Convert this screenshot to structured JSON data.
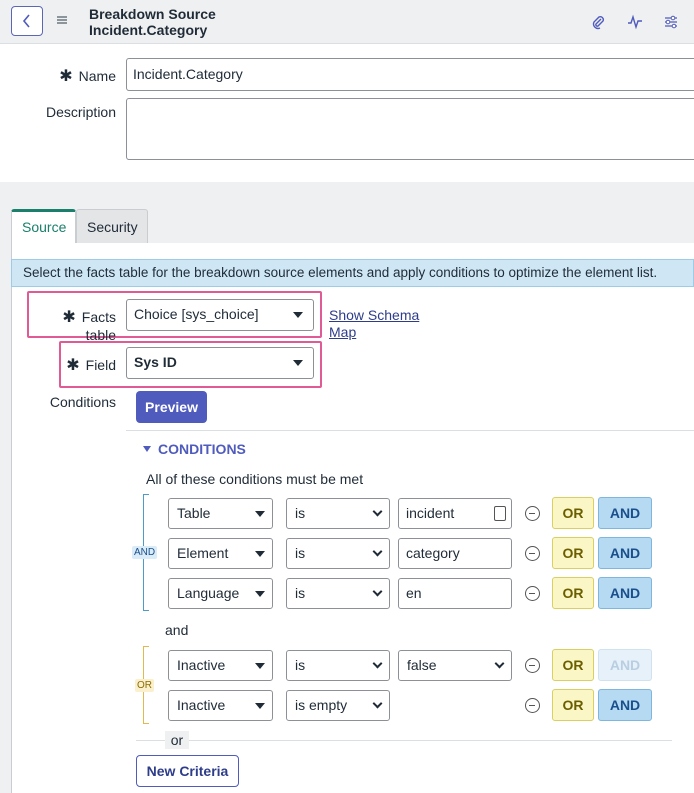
{
  "header": {
    "title_line1": "Breakdown Source",
    "title_line2": "Incident.Category",
    "icons": [
      "back-icon",
      "hamburger-icon",
      "paperclip-icon",
      "activity-icon",
      "settings-sliders-icon"
    ]
  },
  "form": {
    "name_label": "Name",
    "name_value": "Incident.Category",
    "description_label": "Description",
    "description_value": "",
    "required_mark": "✱"
  },
  "tabs": [
    {
      "label": "Source",
      "active": true
    },
    {
      "label": "Security",
      "active": false
    }
  ],
  "source": {
    "info_message": "Select the facts table for the breakdown source elements and apply conditions to optimize the element list.",
    "facts_table_label": "Facts table",
    "facts_table_value": "Choice [sys_choice]",
    "show_schema_line1": "Show Schema",
    "show_schema_line2": "Map",
    "field_label": "Field",
    "field_value": "Sys ID",
    "conditions_label": "Conditions",
    "preview_label": "Preview"
  },
  "conditions": {
    "header": "CONDITIONS",
    "all_met_text": "All of these conditions must be met",
    "and_tag": "AND",
    "or_tag": "OR",
    "group_join": "and",
    "or_separator": "or",
    "new_criteria_label": "New Criteria",
    "or_button_label": "OR",
    "and_button_label": "AND",
    "group1": [
      {
        "field": "Table",
        "operator": "is",
        "value": "incident"
      },
      {
        "field": "Element",
        "operator": "is",
        "value": "category"
      },
      {
        "field": "Language",
        "operator": "is",
        "value": "en"
      }
    ],
    "group2": [
      {
        "field": "Inactive",
        "operator": "is",
        "value": "false"
      },
      {
        "field": "Inactive",
        "operator": "is empty",
        "value": ""
      }
    ]
  },
  "colors": {
    "accent": "#4f5bbd",
    "highlight": "#e05a95",
    "tab_active": "#1a7f6b",
    "info_bar": "#cfe7f5"
  }
}
